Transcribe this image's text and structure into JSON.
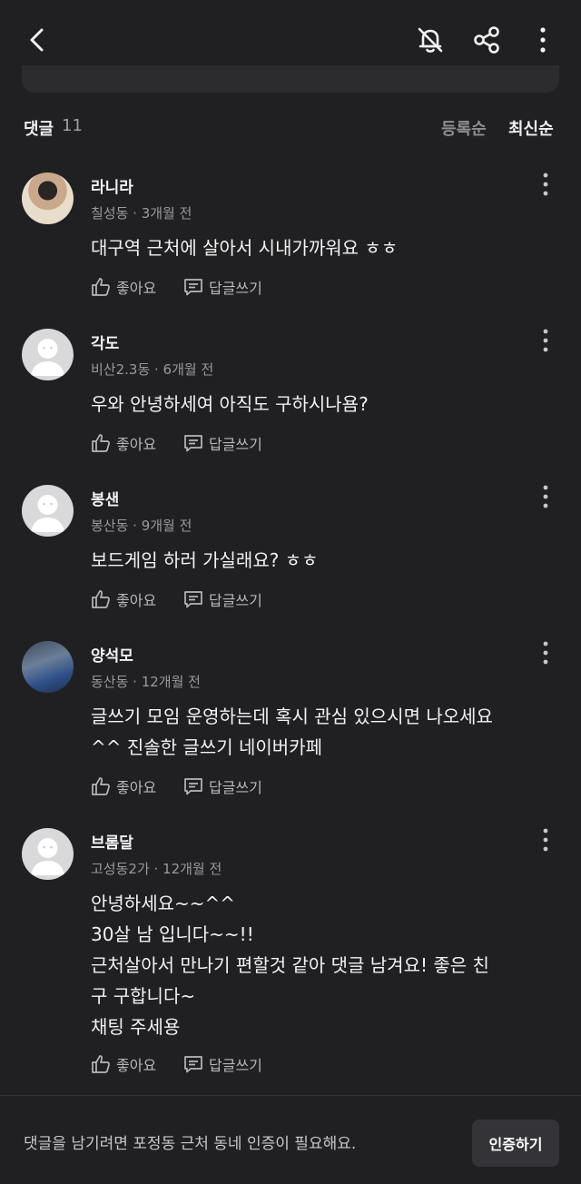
{
  "header": {
    "back_icon": "chevron-left-icon",
    "bell_icon": "bell-off-icon",
    "share_icon": "share-icon",
    "more_icon": "more-vertical-icon"
  },
  "comments_header": {
    "label": "댓글",
    "count": "11",
    "sort_registered": "등록순",
    "sort_latest": "최신순"
  },
  "comments": [
    {
      "name": "라니라",
      "meta": "칠성동 · 3개월 전",
      "lines": [
        "대구역 근처에 살아서 시내가까워요 ㅎㅎ"
      ],
      "like_label": "좋아요",
      "reply_label": "답글쓰기"
    },
    {
      "name": "각도",
      "meta": "비산2.3동 · 6개월 전",
      "lines": [
        "우와 안녕하세여 아직도 구하시나욤?"
      ],
      "like_label": "좋아요",
      "reply_label": "답글쓰기"
    },
    {
      "name": "봉샌",
      "meta": "봉산동 · 9개월 전",
      "lines": [
        "보드게임 하러 가실래요? ㅎㅎ"
      ],
      "like_label": "좋아요",
      "reply_label": "답글쓰기"
    },
    {
      "name": "양석모",
      "meta": "동산동 · 12개월 전",
      "lines": [
        "글쓰기 모임 운영하는데 혹시 관심 있으시면 나오세요",
        "^^ 진솔한 글쓰기 네이버카페"
      ],
      "like_label": "좋아요",
      "reply_label": "답글쓰기"
    },
    {
      "name": "브롬달",
      "meta": "고성동2가 · 12개월 전",
      "lines": [
        "안녕하세요~~^^",
        "30살 남 입니다~~!!",
        "근처살아서 만나기 편할것 같아 댓글 남겨요! 좋은 친",
        "구 구합니다~",
        "채팅 주세용"
      ],
      "like_label": "좋아요",
      "reply_label": "답글쓰기"
    }
  ],
  "bottom": {
    "notice": "댓글을 남기려면 포정동 근처 동네 인증이 필요해요.",
    "verify_button": "인증하기"
  }
}
